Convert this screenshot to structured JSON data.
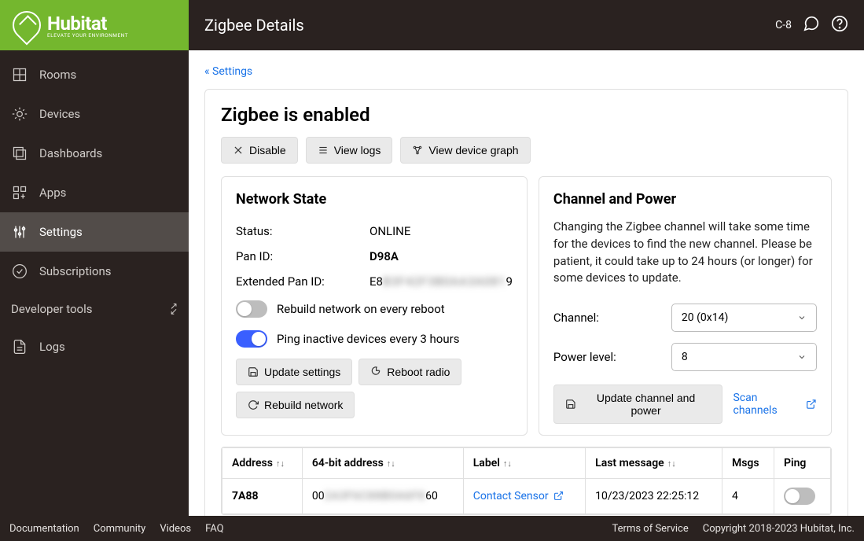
{
  "header": {
    "brand": "Hubitat",
    "brand_sub": "ELEVATE YOUR ENVIRONMENT",
    "title": "Zigbee Details",
    "hub_model": "C-8"
  },
  "sidebar": {
    "items": [
      {
        "label": "Rooms",
        "icon": "rooms"
      },
      {
        "label": "Devices",
        "icon": "bulb"
      },
      {
        "label": "Dashboards",
        "icon": "dashboards"
      },
      {
        "label": "Apps",
        "icon": "apps"
      },
      {
        "label": "Settings",
        "icon": "sliders"
      },
      {
        "label": "Subscriptions",
        "icon": "check"
      }
    ],
    "devtools": "Developer tools",
    "logs": "Logs"
  },
  "breadcrumb": "« Settings",
  "main": {
    "heading": "Zigbee is enabled",
    "buttons": {
      "disable": "Disable",
      "view_logs": "View logs",
      "view_graph": "View device graph"
    },
    "network_state": {
      "title": "Network State",
      "status_label": "Status:",
      "status_value": "ONLINE",
      "pan_label": "Pan ID:",
      "pan_value": "D98A",
      "extpan_label": "Extended Pan ID:",
      "extpan_prefix": "E8",
      "extpan_blur": "B3F42F3B0AA3A081",
      "extpan_suffix": "9",
      "toggle1": "Rebuild network on every reboot",
      "toggle2": "Ping inactive devices every 3 hours",
      "update_settings": "Update settings",
      "reboot_radio": "Reboot radio",
      "rebuild_network": "Rebuild network"
    },
    "channel_power": {
      "title": "Channel and Power",
      "desc": "Changing the Zigbee channel will take some time for the devices to find the new channel. Please be patient, it could take up to 24 hours (or longer) for some devices to update.",
      "channel_label": "Channel:",
      "channel_value": "20 (0x14)",
      "power_label": "Power level:",
      "power_value": "8",
      "update_btn": "Update channel and power",
      "scan_btn": "Scan channels"
    },
    "table": {
      "columns": [
        "Address",
        "64-bit address",
        "Label",
        "Last message",
        "Msgs",
        "Ping"
      ],
      "rows": [
        {
          "address": "7A88",
          "addr64_prefix": "00",
          "addr64_blur": "2A3F6C88B0A6F8",
          "addr64_suffix": "60",
          "label": "Contact Sensor",
          "last": "10/23/2023 22:25:12",
          "msgs": "4"
        }
      ]
    }
  },
  "footer": {
    "links": [
      "Documentation",
      "Community",
      "Videos",
      "FAQ"
    ],
    "tos": "Terms of Service",
    "copyright": "Copyright 2018-2023 Hubitat, Inc."
  }
}
